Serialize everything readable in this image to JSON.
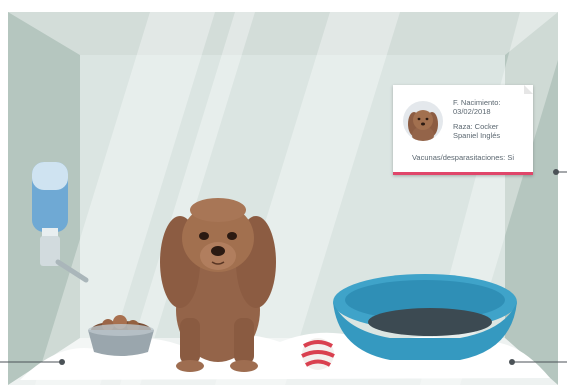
{
  "card": {
    "birth_label": "F. Nacimiento:",
    "birth_value": "03/02/2018",
    "breed_label": "Raza: Cocker",
    "breed_value": "Spaniel Inglés",
    "vaccines": "Vacunas/desparasitaciones: Si"
  },
  "colors": {
    "accent": "#e0466a",
    "wall": "#b9c9c2",
    "glass": "#d6e3de",
    "dog_fur": "#9a6a4f",
    "bed": "#3fa3c9",
    "ball_stripe": "#d9404f"
  },
  "icons": [
    "water-bottle-icon",
    "food-bowl-icon",
    "dog-illustration",
    "ball-icon",
    "dog-bed-icon",
    "dog-avatar-icon"
  ]
}
